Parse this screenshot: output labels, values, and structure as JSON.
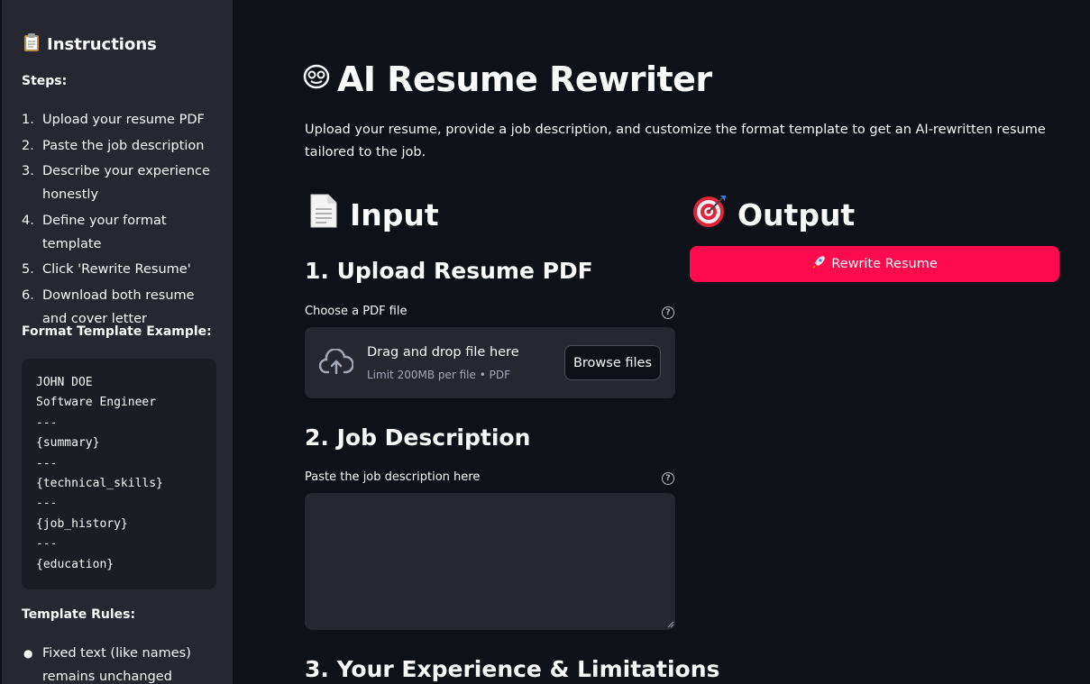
{
  "sidebar": {
    "title": "Instructions",
    "title_icon": "clipboard-icon",
    "steps_heading": "Steps:",
    "steps": [
      {
        "num": "1.",
        "text": "Upload your resume PDF"
      },
      {
        "num": "2.",
        "text": "Paste the job description"
      },
      {
        "num": "3.",
        "text": "Describe your experience honestly"
      },
      {
        "num": "4.",
        "text": "Define your format template"
      },
      {
        "num": "5.",
        "text": "Click 'Rewrite Resume'"
      },
      {
        "num": "6.",
        "text": "Download both resume and cover letter"
      }
    ],
    "format_heading": "Format Template Example:",
    "template_lines": [
      "JOHN DOE",
      "Software Engineer",
      "---",
      "{summary}",
      "---",
      "{technical_skills}",
      "---",
      "{job_history}",
      "---",
      "{education}"
    ],
    "rules_heading": "Template Rules:",
    "rules": [
      "Fixed text (like names) remains unchanged"
    ]
  },
  "main": {
    "title": "AI Resume Rewriter",
    "title_icon": "robot-face-icon",
    "subtitle": "Upload your resume, provide a job description, and customize the format template to get an AI-rewritten resume tailored to the job.",
    "input_heading": "Input",
    "input_icon": "page-document-icon",
    "output_heading": "Output",
    "output_icon": "target-icon",
    "section1": "1. Upload Resume PDF",
    "upload_label": "Choose a PDF file",
    "dropzone_main": "Drag and drop file here",
    "dropzone_sub": "Limit 200MB per file • PDF",
    "browse_label": "Browse files",
    "section2": "2. Job Description",
    "jd_label": "Paste the job description here",
    "jd_value": "",
    "section3": "3. Your Experience & Limitations",
    "rewrite_label": "Rewrite Resume",
    "rewrite_icon": "rocket-icon"
  },
  "colors": {
    "background": "#0e1117",
    "sidebar": "#262730",
    "input_bg": "#262730",
    "primary": "#ff0a4f",
    "text": "#fafafa"
  }
}
